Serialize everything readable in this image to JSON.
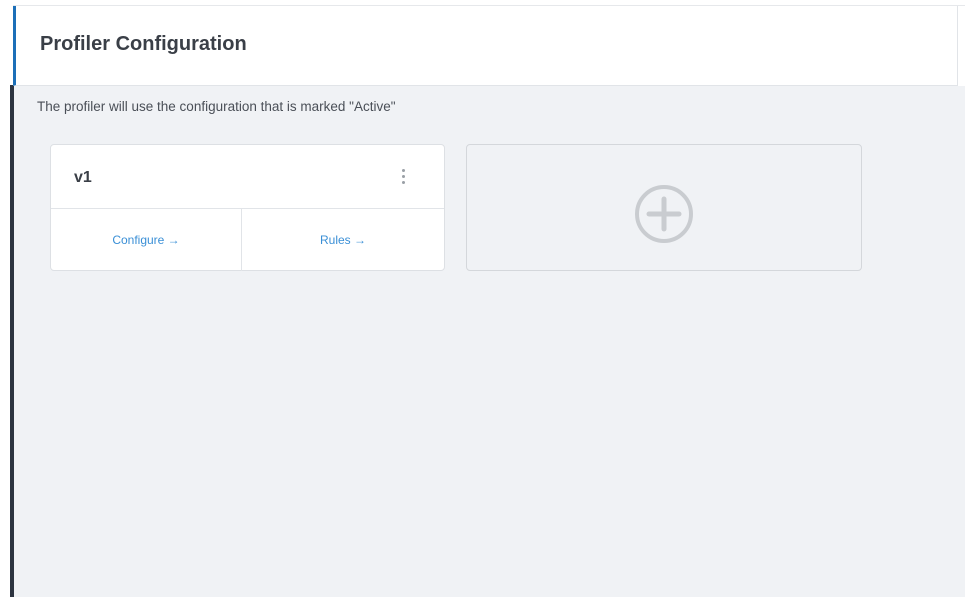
{
  "header": {
    "title": "Profiler Configuration"
  },
  "info": {
    "text": "The profiler will use the configuration that is marked \"Active\""
  },
  "configurations": [
    {
      "name": "v1",
      "menu_icon": "vertical-ellipsis-icon",
      "actions": {
        "configure_label": "Configure →",
        "rules_label": "Rules →"
      }
    }
  ],
  "add_card": {
    "icon": "plus-circle-icon"
  },
  "colors": {
    "accent": "#1c6fb8",
    "link": "#3a8fd6",
    "background": "#f0f2f5",
    "title": "#3a3f47"
  }
}
